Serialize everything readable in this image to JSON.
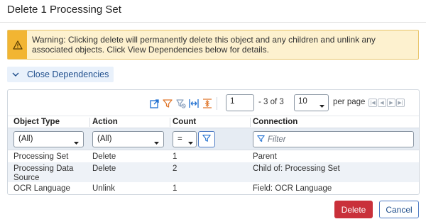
{
  "dialog": {
    "title": "Delete 1 Processing Set"
  },
  "warning": {
    "icon": "warning-icon",
    "text": "Warning: Clicking delete will permanently delete this object and any children and unlink any associated objects. Click View Dependencies below for details."
  },
  "dependencies_toggle": {
    "label": "Close Dependencies",
    "icon": "chevron-down-icon"
  },
  "toolbar": {
    "icons": [
      "export-icon",
      "filter-icon",
      "clear-filter-icon",
      "fit-columns-icon",
      "collapse-rows-icon"
    ],
    "page_value": "1",
    "page_of": "- 3 of 3",
    "page_size": "10",
    "per_page_label": "per page",
    "pager_icons": [
      "first-page-icon",
      "prev-page-icon",
      "next-page-icon",
      "last-page-icon"
    ]
  },
  "table": {
    "headers": [
      "Object Type",
      "Action",
      "Count",
      "Connection"
    ],
    "filters": {
      "object_type": "(All)",
      "action": "(All)",
      "count_operator": "=",
      "connection_placeholder": "Filter"
    },
    "rows": [
      [
        "Processing Set",
        "Delete",
        "1",
        "Parent"
      ],
      [
        "Processing Data\nSource",
        "Delete",
        "2",
        "Child of: Processing Set"
      ],
      [
        "OCR Language",
        "Unlink",
        "1",
        "Field: OCR Language"
      ]
    ]
  },
  "buttons": {
    "delete": "Delete",
    "cancel": "Cancel"
  },
  "colors": {
    "danger": "#c9303a",
    "accent": "#1f4e8c",
    "toolbar_icon": "#1f6fd1",
    "toolbar_icon_orange": "#e0762a",
    "warning_bg": "#fdf1cf",
    "warning_icon_bg": "#f2b532"
  }
}
